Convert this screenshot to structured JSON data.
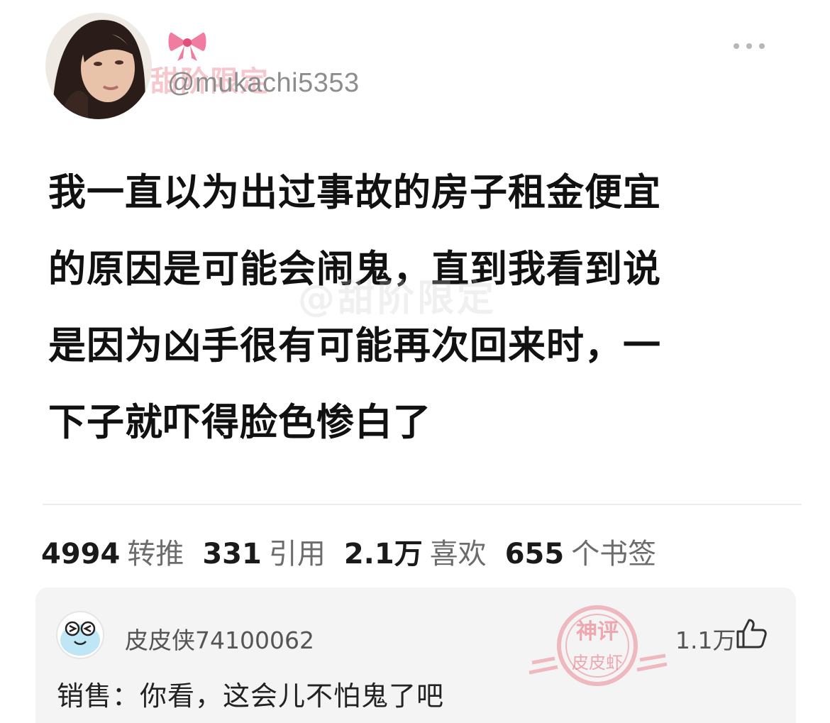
{
  "tweet": {
    "avatar_icon": "user-avatar-photo",
    "bow_icon": "pink-bow-icon",
    "watermark_top": "甜阶限定",
    "handle": "@mukachi5353",
    "more_icon": "more-horizontal-icon",
    "text_lines": [
      "我一直以为出过事故的房子租金便宜",
      "的原因是可能会闹鬼，直到我看到说",
      "是因为凶手很有可能再次回来时，一",
      "下子就吓得脸色惨白了"
    ],
    "watermark_mid": "@甜阶限定",
    "stats": [
      {
        "num": "4994",
        "label": "转推"
      },
      {
        "num": "331",
        "label": "引用"
      },
      {
        "num": "2.1万",
        "label": "喜欢"
      },
      {
        "num": "655",
        "label": "个书签"
      }
    ]
  },
  "comment": {
    "avatar_icon": "laughing-face-avatar",
    "username": "皮皮侠74100062",
    "likes": "1.1万",
    "like_icon": "thumbs-up-icon",
    "text": "销售：你看，这会儿不怕鬼了吧",
    "stamp_top": "神评",
    "stamp_bottom": "皮皮虾",
    "stamp_color": "#e8485b"
  }
}
